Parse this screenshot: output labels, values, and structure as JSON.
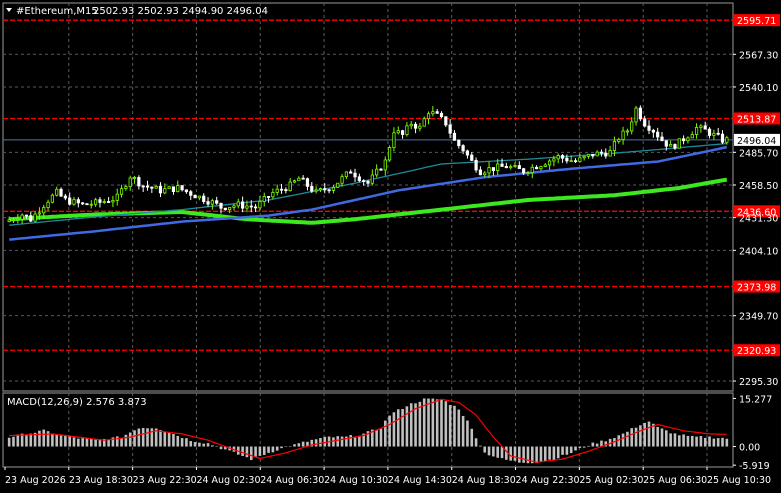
{
  "header": {
    "symbol": "#Ethereum,M15",
    "ohlc": "2502.93 2502.93 2494.90 2496.04"
  },
  "macd_header": {
    "label": "MACD(12,26,9) 2.576 3.873"
  },
  "colors": {
    "background": "#000000",
    "grid": "#5a5a5a",
    "bull_candle": "#7cfc00",
    "bear_candle": "#ffffff",
    "resistance_line": "#ff0000",
    "resistance_label_bg": "#ff0000",
    "ma_fast": "#1f8a99",
    "ma_mid": "#4169e1",
    "ma_slow": "#3ce81e",
    "price_line": "#4a78a8",
    "macd_hist": "#c0c0c0",
    "macd_signal": "#ff0000"
  },
  "chart_data": {
    "type": "candlestick",
    "price_axis": {
      "range": [
        2287.0,
        2610.0
      ],
      "ticks": [
        {
          "value": 2567.3,
          "label": "2567.30"
        },
        {
          "value": 2540.1,
          "label": "2540.10"
        },
        {
          "value": 2485.7,
          "label": "2485.70"
        },
        {
          "value": 2458.5,
          "label": "2458.50"
        },
        {
          "value": 2431.3,
          "label": "2431.30"
        },
        {
          "value": 2404.1,
          "label": "2404.10"
        },
        {
          "value": 2349.7,
          "label": "2349.70"
        },
        {
          "value": 2295.3,
          "label": "2295.30"
        }
      ]
    },
    "current_price": {
      "value": 2496.04,
      "label": "2496.04"
    },
    "horizontal_levels": [
      {
        "value": 2595.71,
        "label": "2595.71"
      },
      {
        "value": 2513.87,
        "label": "2513.87"
      },
      {
        "value": 2436.6,
        "label": "2436.60"
      },
      {
        "value": 2373.98,
        "label": "2373.98"
      },
      {
        "value": 2320.93,
        "label": "2320.93"
      }
    ],
    "time_labels": [
      "23 Aug 2026",
      "23 Aug 18:30",
      "23 Aug 22:30",
      "24 Aug 02:30",
      "24 Aug 06:30",
      "24 Aug 10:30",
      "24 Aug 14:30",
      "24 Aug 18:30",
      "24 Aug 22:30",
      "25 Aug 02:30",
      "25 Aug 06:30",
      "25 Aug 10:30"
    ],
    "price_path_keypoints": [
      [
        0,
        2428
      ],
      [
        4,
        2434
      ],
      [
        6,
        2430
      ],
      [
        8,
        2438
      ],
      [
        10,
        2446
      ],
      [
        12,
        2452
      ],
      [
        14,
        2446
      ],
      [
        18,
        2442
      ],
      [
        22,
        2444
      ],
      [
        26,
        2448
      ],
      [
        29,
        2466
      ],
      [
        32,
        2458
      ],
      [
        36,
        2454
      ],
      [
        40,
        2456
      ],
      [
        44,
        2450
      ],
      [
        48,
        2444
      ],
      [
        50,
        2440
      ],
      [
        54,
        2442
      ],
      [
        58,
        2440
      ],
      [
        62,
        2452
      ],
      [
        66,
        2458
      ],
      [
        68,
        2464
      ],
      [
        72,
        2452
      ],
      [
        76,
        2458
      ],
      [
        80,
        2470
      ],
      [
        84,
        2460
      ],
      [
        88,
        2478
      ],
      [
        90,
        2504
      ],
      [
        92,
        2500
      ],
      [
        94,
        2510
      ],
      [
        96,
        2506
      ],
      [
        98,
        2520
      ],
      [
        100,
        2516
      ],
      [
        102,
        2510
      ],
      [
        104,
        2495
      ],
      [
        106,
        2488
      ],
      [
        108,
        2478
      ],
      [
        110,
        2470
      ],
      [
        112,
        2472
      ],
      [
        116,
        2474
      ],
      [
        120,
        2470
      ],
      [
        124,
        2476
      ],
      [
        128,
        2482
      ],
      [
        132,
        2478
      ],
      [
        136,
        2484
      ],
      [
        140,
        2486
      ],
      [
        142,
        2498
      ],
      [
        144,
        2504
      ],
      [
        146,
        2522
      ],
      [
        148,
        2510
      ],
      [
        150,
        2504
      ],
      [
        152,
        2496
      ],
      [
        154,
        2490
      ],
      [
        156,
        2494
      ],
      [
        158,
        2500
      ],
      [
        160,
        2506
      ],
      [
        162,
        2504
      ],
      [
        164,
        2500
      ],
      [
        166,
        2496
      ]
    ],
    "ma_fast": {
      "points": [
        [
          0,
          2425
        ],
        [
          20,
          2432
        ],
        [
          40,
          2438
        ],
        [
          60,
          2446
        ],
        [
          80,
          2460
        ],
        [
          100,
          2476
        ],
        [
          120,
          2480
        ],
        [
          140,
          2485
        ],
        [
          150,
          2488
        ],
        [
          166,
          2493
        ]
      ]
    },
    "ma_mid": {
      "points": [
        [
          0,
          2413
        ],
        [
          20,
          2420
        ],
        [
          40,
          2428
        ],
        [
          60,
          2433
        ],
        [
          70,
          2438
        ],
        [
          90,
          2454
        ],
        [
          110,
          2465
        ],
        [
          130,
          2472
        ],
        [
          150,
          2478
        ],
        [
          166,
          2490
        ]
      ]
    },
    "ma_slow": {
      "points": [
        [
          0,
          2430
        ],
        [
          20,
          2434
        ],
        [
          40,
          2436
        ],
        [
          55,
          2430
        ],
        [
          70,
          2427
        ],
        [
          80,
          2430
        ],
        [
          100,
          2438
        ],
        [
          120,
          2446
        ],
        [
          140,
          2450
        ],
        [
          155,
          2456
        ],
        [
          166,
          2463
        ]
      ]
    },
    "macd": {
      "range": [
        -6.5,
        17.0
      ],
      "ticks": [
        {
          "value": 15.277,
          "label": "15.277"
        },
        {
          "value": 0.0,
          "label": "0.00"
        },
        {
          "value": -5.919,
          "label": "-5.919"
        }
      ],
      "hist_keypoints": [
        [
          0,
          3
        ],
        [
          8,
          5
        ],
        [
          14,
          3
        ],
        [
          20,
          2
        ],
        [
          26,
          3
        ],
        [
          30,
          6
        ],
        [
          34,
          6
        ],
        [
          38,
          4
        ],
        [
          42,
          2
        ],
        [
          46,
          1
        ],
        [
          50,
          -1
        ],
        [
          54,
          -3
        ],
        [
          56,
          -4
        ],
        [
          58,
          -3
        ],
        [
          62,
          -1
        ],
        [
          66,
          0.5
        ],
        [
          70,
          2
        ],
        [
          74,
          3
        ],
        [
          78,
          3
        ],
        [
          82,
          4
        ],
        [
          86,
          6
        ],
        [
          88,
          10
        ],
        [
          92,
          13
        ],
        [
          96,
          15
        ],
        [
          100,
          15
        ],
        [
          104,
          12
        ],
        [
          106,
          8
        ],
        [
          108,
          3
        ],
        [
          110,
          -2
        ],
        [
          114,
          -4
        ],
        [
          118,
          -5
        ],
        [
          122,
          -5
        ],
        [
          126,
          -4
        ],
        [
          130,
          -2
        ],
        [
          134,
          0.5
        ],
        [
          138,
          2
        ],
        [
          142,
          4
        ],
        [
          146,
          7
        ],
        [
          148,
          8
        ],
        [
          150,
          6
        ],
        [
          154,
          4
        ],
        [
          158,
          3
        ],
        [
          162,
          3
        ],
        [
          166,
          2.6
        ]
      ],
      "signal_keypoints": [
        [
          0,
          3.5
        ],
        [
          10,
          4
        ],
        [
          16,
          3
        ],
        [
          22,
          2
        ],
        [
          28,
          3
        ],
        [
          34,
          5
        ],
        [
          40,
          4
        ],
        [
          46,
          2
        ],
        [
          52,
          -1
        ],
        [
          58,
          -3.8
        ],
        [
          64,
          -2
        ],
        [
          70,
          0.5
        ],
        [
          76,
          2
        ],
        [
          82,
          3.5
        ],
        [
          88,
          7
        ],
        [
          94,
          12
        ],
        [
          100,
          15
        ],
        [
          104,
          14
        ],
        [
          108,
          10
        ],
        [
          112,
          3
        ],
        [
          116,
          -3
        ],
        [
          122,
          -5
        ],
        [
          128,
          -4
        ],
        [
          134,
          -1.5
        ],
        [
          140,
          1.5
        ],
        [
          146,
          5
        ],
        [
          150,
          7
        ],
        [
          156,
          5
        ],
        [
          162,
          4
        ],
        [
          166,
          3.9
        ]
      ]
    }
  }
}
